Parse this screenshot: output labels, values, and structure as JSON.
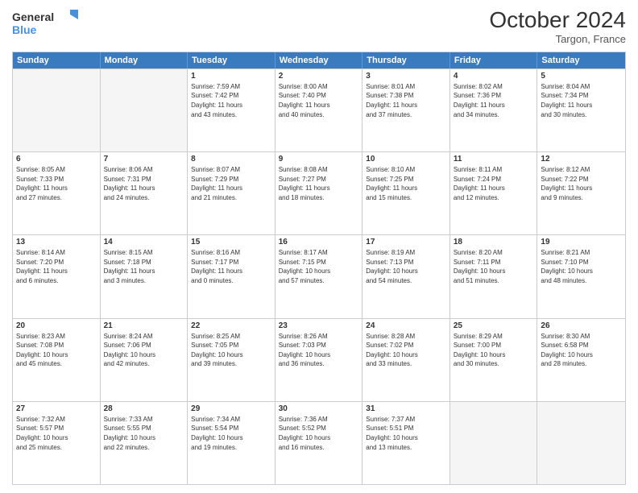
{
  "header": {
    "logo_general": "General",
    "logo_blue": "Blue",
    "month_title": "October 2024",
    "location": "Targon, France"
  },
  "days_of_week": [
    "Sunday",
    "Monday",
    "Tuesday",
    "Wednesday",
    "Thursday",
    "Friday",
    "Saturday"
  ],
  "rows": [
    [
      {
        "day": "",
        "lines": [],
        "empty": true
      },
      {
        "day": "",
        "lines": [],
        "empty": true
      },
      {
        "day": "1",
        "lines": [
          "Sunrise: 7:59 AM",
          "Sunset: 7:42 PM",
          "Daylight: 11 hours",
          "and 43 minutes."
        ]
      },
      {
        "day": "2",
        "lines": [
          "Sunrise: 8:00 AM",
          "Sunset: 7:40 PM",
          "Daylight: 11 hours",
          "and 40 minutes."
        ]
      },
      {
        "day": "3",
        "lines": [
          "Sunrise: 8:01 AM",
          "Sunset: 7:38 PM",
          "Daylight: 11 hours",
          "and 37 minutes."
        ]
      },
      {
        "day": "4",
        "lines": [
          "Sunrise: 8:02 AM",
          "Sunset: 7:36 PM",
          "Daylight: 11 hours",
          "and 34 minutes."
        ]
      },
      {
        "day": "5",
        "lines": [
          "Sunrise: 8:04 AM",
          "Sunset: 7:34 PM",
          "Daylight: 11 hours",
          "and 30 minutes."
        ]
      }
    ],
    [
      {
        "day": "6",
        "lines": [
          "Sunrise: 8:05 AM",
          "Sunset: 7:33 PM",
          "Daylight: 11 hours",
          "and 27 minutes."
        ]
      },
      {
        "day": "7",
        "lines": [
          "Sunrise: 8:06 AM",
          "Sunset: 7:31 PM",
          "Daylight: 11 hours",
          "and 24 minutes."
        ]
      },
      {
        "day": "8",
        "lines": [
          "Sunrise: 8:07 AM",
          "Sunset: 7:29 PM",
          "Daylight: 11 hours",
          "and 21 minutes."
        ]
      },
      {
        "day": "9",
        "lines": [
          "Sunrise: 8:08 AM",
          "Sunset: 7:27 PM",
          "Daylight: 11 hours",
          "and 18 minutes."
        ]
      },
      {
        "day": "10",
        "lines": [
          "Sunrise: 8:10 AM",
          "Sunset: 7:25 PM",
          "Daylight: 11 hours",
          "and 15 minutes."
        ]
      },
      {
        "day": "11",
        "lines": [
          "Sunrise: 8:11 AM",
          "Sunset: 7:24 PM",
          "Daylight: 11 hours",
          "and 12 minutes."
        ]
      },
      {
        "day": "12",
        "lines": [
          "Sunrise: 8:12 AM",
          "Sunset: 7:22 PM",
          "Daylight: 11 hours",
          "and 9 minutes."
        ]
      }
    ],
    [
      {
        "day": "13",
        "lines": [
          "Sunrise: 8:14 AM",
          "Sunset: 7:20 PM",
          "Daylight: 11 hours",
          "and 6 minutes."
        ]
      },
      {
        "day": "14",
        "lines": [
          "Sunrise: 8:15 AM",
          "Sunset: 7:18 PM",
          "Daylight: 11 hours",
          "and 3 minutes."
        ]
      },
      {
        "day": "15",
        "lines": [
          "Sunrise: 8:16 AM",
          "Sunset: 7:17 PM",
          "Daylight: 11 hours",
          "and 0 minutes."
        ]
      },
      {
        "day": "16",
        "lines": [
          "Sunrise: 8:17 AM",
          "Sunset: 7:15 PM",
          "Daylight: 10 hours",
          "and 57 minutes."
        ]
      },
      {
        "day": "17",
        "lines": [
          "Sunrise: 8:19 AM",
          "Sunset: 7:13 PM",
          "Daylight: 10 hours",
          "and 54 minutes."
        ]
      },
      {
        "day": "18",
        "lines": [
          "Sunrise: 8:20 AM",
          "Sunset: 7:11 PM",
          "Daylight: 10 hours",
          "and 51 minutes."
        ]
      },
      {
        "day": "19",
        "lines": [
          "Sunrise: 8:21 AM",
          "Sunset: 7:10 PM",
          "Daylight: 10 hours",
          "and 48 minutes."
        ]
      }
    ],
    [
      {
        "day": "20",
        "lines": [
          "Sunrise: 8:23 AM",
          "Sunset: 7:08 PM",
          "Daylight: 10 hours",
          "and 45 minutes."
        ]
      },
      {
        "day": "21",
        "lines": [
          "Sunrise: 8:24 AM",
          "Sunset: 7:06 PM",
          "Daylight: 10 hours",
          "and 42 minutes."
        ]
      },
      {
        "day": "22",
        "lines": [
          "Sunrise: 8:25 AM",
          "Sunset: 7:05 PM",
          "Daylight: 10 hours",
          "and 39 minutes."
        ]
      },
      {
        "day": "23",
        "lines": [
          "Sunrise: 8:26 AM",
          "Sunset: 7:03 PM",
          "Daylight: 10 hours",
          "and 36 minutes."
        ]
      },
      {
        "day": "24",
        "lines": [
          "Sunrise: 8:28 AM",
          "Sunset: 7:02 PM",
          "Daylight: 10 hours",
          "and 33 minutes."
        ]
      },
      {
        "day": "25",
        "lines": [
          "Sunrise: 8:29 AM",
          "Sunset: 7:00 PM",
          "Daylight: 10 hours",
          "and 30 minutes."
        ]
      },
      {
        "day": "26",
        "lines": [
          "Sunrise: 8:30 AM",
          "Sunset: 6:58 PM",
          "Daylight: 10 hours",
          "and 28 minutes."
        ]
      }
    ],
    [
      {
        "day": "27",
        "lines": [
          "Sunrise: 7:32 AM",
          "Sunset: 5:57 PM",
          "Daylight: 10 hours",
          "and 25 minutes."
        ]
      },
      {
        "day": "28",
        "lines": [
          "Sunrise: 7:33 AM",
          "Sunset: 5:55 PM",
          "Daylight: 10 hours",
          "and 22 minutes."
        ]
      },
      {
        "day": "29",
        "lines": [
          "Sunrise: 7:34 AM",
          "Sunset: 5:54 PM",
          "Daylight: 10 hours",
          "and 19 minutes."
        ]
      },
      {
        "day": "30",
        "lines": [
          "Sunrise: 7:36 AM",
          "Sunset: 5:52 PM",
          "Daylight: 10 hours",
          "and 16 minutes."
        ]
      },
      {
        "day": "31",
        "lines": [
          "Sunrise: 7:37 AM",
          "Sunset: 5:51 PM",
          "Daylight: 10 hours",
          "and 13 minutes."
        ]
      },
      {
        "day": "",
        "lines": [],
        "empty": true
      },
      {
        "day": "",
        "lines": [],
        "empty": true
      }
    ]
  ]
}
